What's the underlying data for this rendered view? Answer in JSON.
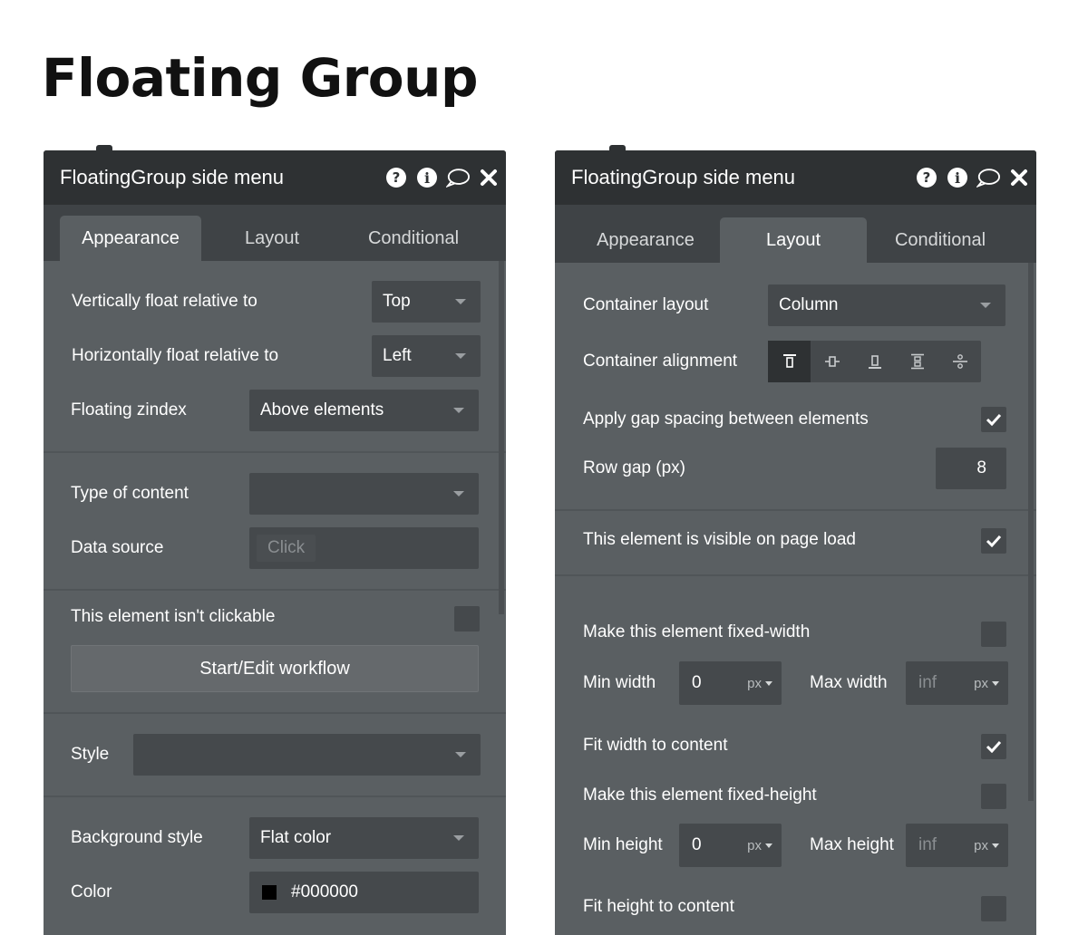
{
  "page": {
    "title": "Floating Group"
  },
  "left_panel": {
    "title": "FloatingGroup side menu",
    "header_icons": [
      "help-icon",
      "info-icon",
      "comment-icon",
      "close-icon"
    ],
    "tabs": [
      {
        "label": "Appearance",
        "active": true
      },
      {
        "label": "Layout",
        "active": false
      },
      {
        "label": "Conditional",
        "active": false
      }
    ],
    "fields": {
      "vertical_float": {
        "label": "Vertically float relative to",
        "value": "Top"
      },
      "horizontal_float": {
        "label": "Horizontally float relative to",
        "value": "Left"
      },
      "zindex": {
        "label": "Floating zindex",
        "value": "Above elements"
      },
      "type_of_content": {
        "label": "Type of content",
        "value": ""
      },
      "data_source": {
        "label": "Data source",
        "placeholder": "Click"
      },
      "not_clickable": {
        "label": "This element isn't clickable",
        "checked": false
      },
      "workflow_button": {
        "label": "Start/Edit workflow"
      },
      "style": {
        "label": "Style",
        "value": ""
      },
      "background_style": {
        "label": "Background style",
        "value": "Flat color"
      },
      "color": {
        "label": "Color",
        "value": "#000000",
        "swatch": "#000000"
      }
    }
  },
  "right_panel": {
    "title": "FloatingGroup side menu",
    "header_icons": [
      "help-icon",
      "info-icon",
      "comment-icon",
      "close-icon"
    ],
    "tabs": [
      {
        "label": "Appearance",
        "active": false
      },
      {
        "label": "Layout",
        "active": true
      },
      {
        "label": "Conditional",
        "active": false
      }
    ],
    "fields": {
      "container_layout": {
        "label": "Container layout",
        "value": "Column"
      },
      "container_alignment": {
        "label": "Container alignment",
        "options": [
          "align-top",
          "align-center-vertical",
          "align-bottom",
          "space-between",
          "space-around"
        ],
        "selected": "align-top"
      },
      "gap_spacing": {
        "label": "Apply gap spacing between elements",
        "checked": true
      },
      "row_gap": {
        "label": "Row gap (px)",
        "value": "8"
      },
      "visible_on_load": {
        "label": "This element is visible on page load",
        "checked": true
      },
      "fixed_width": {
        "label": "Make this element fixed-width",
        "checked": false
      },
      "min_width": {
        "label": "Min width",
        "value": "0",
        "unit": "px"
      },
      "max_width": {
        "label": "Max width",
        "value": "inf",
        "unit": "px"
      },
      "fit_width": {
        "label": "Fit width to content",
        "checked": true
      },
      "fixed_height": {
        "label": "Make this element fixed-height",
        "checked": false
      },
      "min_height": {
        "label": "Min height",
        "value": "0",
        "unit": "px"
      },
      "max_height": {
        "label": "Max height",
        "value": "inf",
        "unit": "px"
      },
      "fit_height": {
        "label": "Fit height to content",
        "checked": false
      }
    }
  },
  "colors": {
    "panel_bg": "#5a5f62",
    "header_bg": "#2e3133",
    "tabs_bg": "#3f4346",
    "input_bg": "#45494c"
  }
}
